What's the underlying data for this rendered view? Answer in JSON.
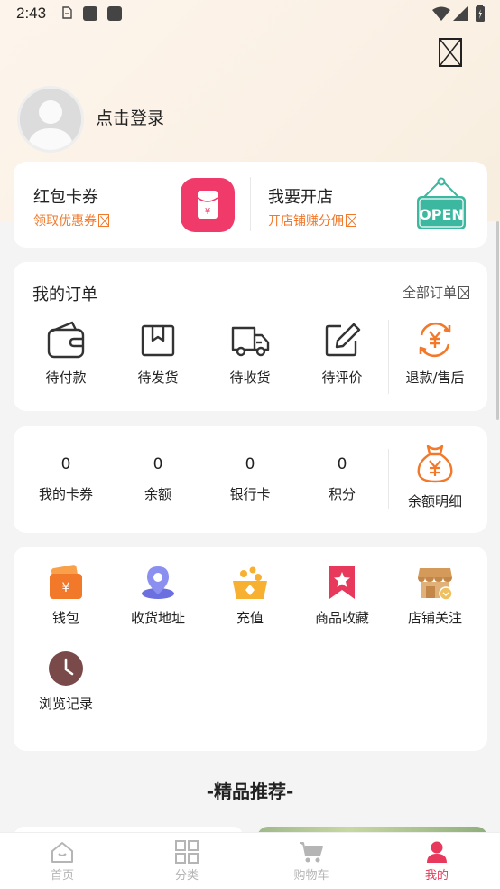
{
  "status_bar": {
    "time": "2:43"
  },
  "profile": {
    "login_text": "点击登录"
  },
  "promo": {
    "left": {
      "title": "红包卡券",
      "subtitle": "领取优惠券"
    },
    "right": {
      "title": "我要开店",
      "subtitle": "开店铺赚分佣",
      "sign_text": "OPEN"
    }
  },
  "orders": {
    "title": "我的订单",
    "all_link": "全部订单",
    "items": [
      {
        "label": "待付款",
        "icon": "wallet-icon"
      },
      {
        "label": "待发货",
        "icon": "box-icon"
      },
      {
        "label": "待收货",
        "icon": "truck-icon"
      },
      {
        "label": "待评价",
        "icon": "edit-icon"
      },
      {
        "label": "退款/售后",
        "icon": "refund-icon"
      }
    ]
  },
  "assets": {
    "items": [
      {
        "value": "0",
        "label": "我的卡券"
      },
      {
        "value": "0",
        "label": "余额"
      },
      {
        "value": "0",
        "label": "银行卡"
      },
      {
        "value": "0",
        "label": "积分"
      }
    ],
    "detail_label": "余额明细"
  },
  "services": {
    "items": [
      {
        "label": "钱包",
        "icon": "wallet-orange-icon"
      },
      {
        "label": "收货地址",
        "icon": "location-icon"
      },
      {
        "label": "充值",
        "icon": "recharge-icon"
      },
      {
        "label": "商品收藏",
        "icon": "bookmark-star-icon"
      },
      {
        "label": "店铺关注",
        "icon": "store-icon"
      },
      {
        "label": "浏览记录",
        "icon": "clock-icon"
      }
    ]
  },
  "recommend": {
    "title": "-精品推荐-"
  },
  "tabbar": {
    "items": [
      {
        "label": "首页",
        "icon": "home-icon",
        "active": false
      },
      {
        "label": "分类",
        "icon": "grid-icon",
        "active": false
      },
      {
        "label": "购物车",
        "icon": "cart-icon",
        "active": false
      },
      {
        "label": "我的",
        "icon": "user-icon",
        "active": true
      }
    ]
  },
  "colors": {
    "accent": "#e8385b",
    "orange": "#f2782a",
    "purple": "#6b6fe0",
    "brown": "#7a4a4a",
    "teal": "#3cb8a0"
  }
}
